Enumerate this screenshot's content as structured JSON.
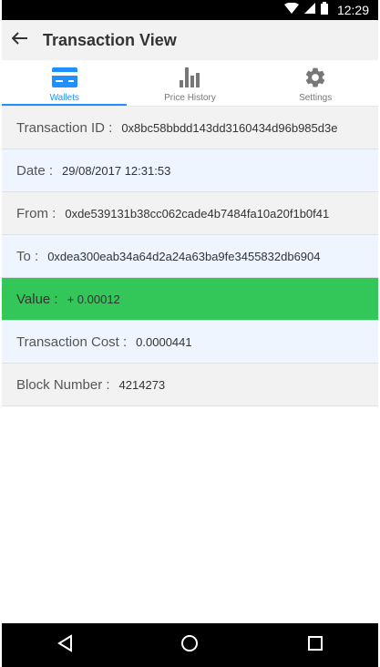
{
  "statusbar": {
    "time": "12:29"
  },
  "appbar": {
    "title": "Transaction View"
  },
  "tabs": [
    {
      "label": "Wallets",
      "icon": "wallet-card-icon",
      "active": true
    },
    {
      "label": "Price History",
      "icon": "bar-chart-icon",
      "active": false
    },
    {
      "label": "Settings",
      "icon": "gear-icon",
      "active": false
    }
  ],
  "details": {
    "transaction_id": {
      "label": "Transaction ID :",
      "value": "0x8bc58bbdd143dd3160434d96b985d3e"
    },
    "date": {
      "label": "Date :",
      "value": "29/08/2017 12:31:53"
    },
    "from": {
      "label": "From :",
      "value": "0xde539131b38cc062cade4b7484fa10a20f1b0f41"
    },
    "to": {
      "label": "To :",
      "value": "0xdea300eab34a64d2a24a63ba9fe3455832db6904"
    },
    "value": {
      "label": "Value :",
      "value": "+ 0.00012"
    },
    "transaction_cost": {
      "label": "Transaction Cost :",
      "value": "0.0000441"
    },
    "block_number": {
      "label": "Block Number :",
      "value": "4214273"
    }
  },
  "colors": {
    "accent": "#1e90ff",
    "value_row": "#33c759"
  }
}
